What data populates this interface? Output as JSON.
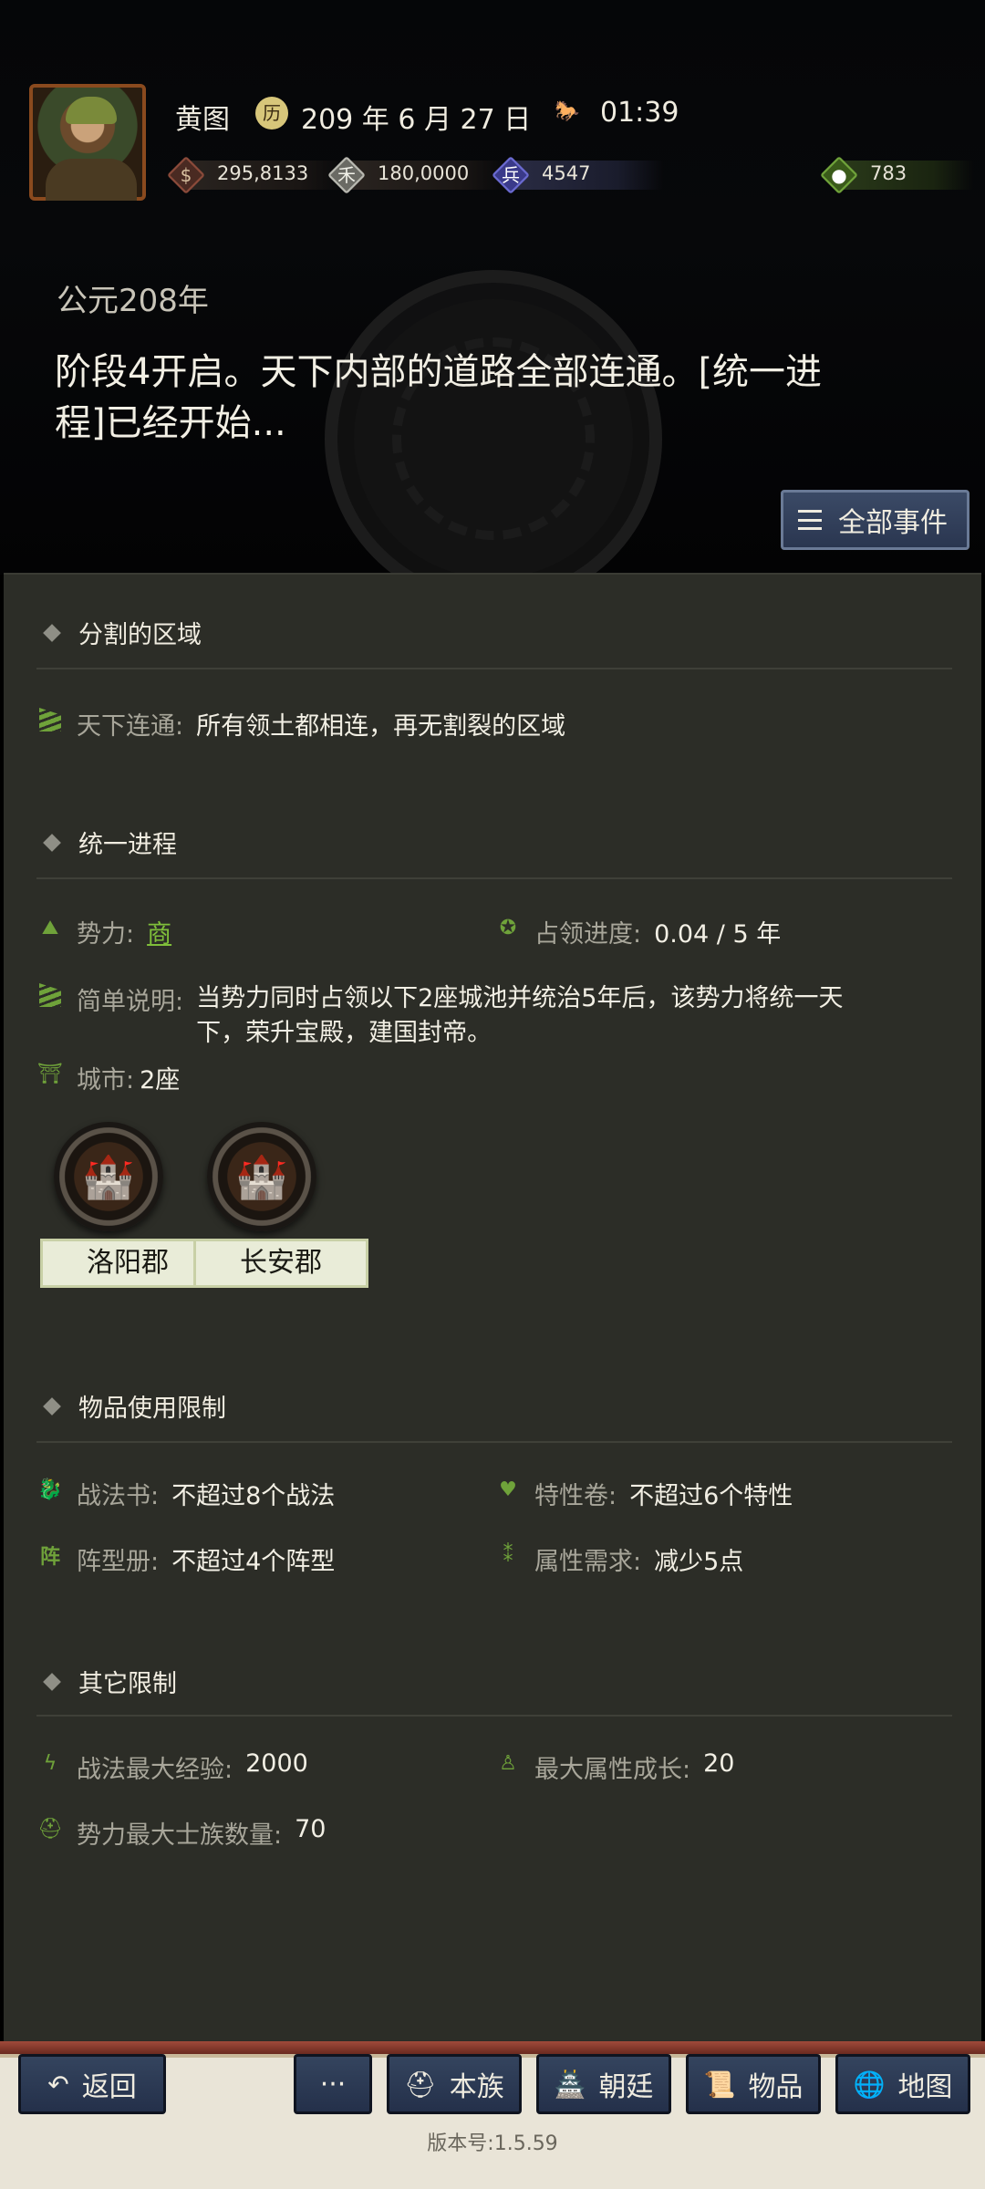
{
  "header": {
    "player_name": "黄图",
    "date": "209 年 6 月 27 日",
    "time": "01:39",
    "resources": [
      {
        "icon": "coin-icon",
        "value": "295,8133",
        "color": "#8a4a3a"
      },
      {
        "icon": "grain-icon",
        "value": "180,0000",
        "color": "#b8b8b0"
      },
      {
        "icon": "soldier-icon",
        "value": "4547",
        "color": "#6a6ad0"
      },
      {
        "icon": "pouch-icon",
        "value": "783",
        "color": "#6fa23a"
      }
    ]
  },
  "event": {
    "year": "公元208年",
    "text": "阶段4开启。天下内部的道路全部连通。[统一进程]已经开始..."
  },
  "all_events_label": "全部事件",
  "sections": {
    "divided": {
      "title": "分割的区域",
      "connect_label": "天下连通:",
      "connect_value": "所有领土都相连，再无割裂的区域"
    },
    "unify": {
      "title": "统一进程",
      "faction_label": "势力:",
      "faction_value": "商",
      "progress_label": "占领进度:",
      "progress_value": "0.04 / 5 年",
      "desc_label": "简单说明:",
      "desc_value": "当势力同时占领以下2座城池并统治5年后，该势力将统一天下，荣升宝殿，建国封帝。",
      "city_label": "城市:",
      "city_value": "2座",
      "cities": [
        "洛阳郡",
        "长安郡"
      ]
    },
    "items": {
      "title": "物品使用限制",
      "book_label": "战法书:",
      "book_value": "不超过8个战法",
      "trait_label": "特性卷:",
      "trait_value": "不超过6个特性",
      "formation_label": "阵型册:",
      "formation_value": "不超过4个阵型",
      "attr_label": "属性需求:",
      "attr_value": "减少5点"
    },
    "other": {
      "title": "其它限制",
      "exp_label": "战法最大经验:",
      "exp_value": "2000",
      "growth_label": "最大属性成长:",
      "growth_value": "20",
      "clan_label": "势力最大士族数量:",
      "clan_value": "70"
    }
  },
  "nav": {
    "back": "返回",
    "more": "···",
    "clan": "本族",
    "court": "朝廷",
    "items": "物品",
    "map": "地图"
  },
  "version": "版本号:1.5.59"
}
